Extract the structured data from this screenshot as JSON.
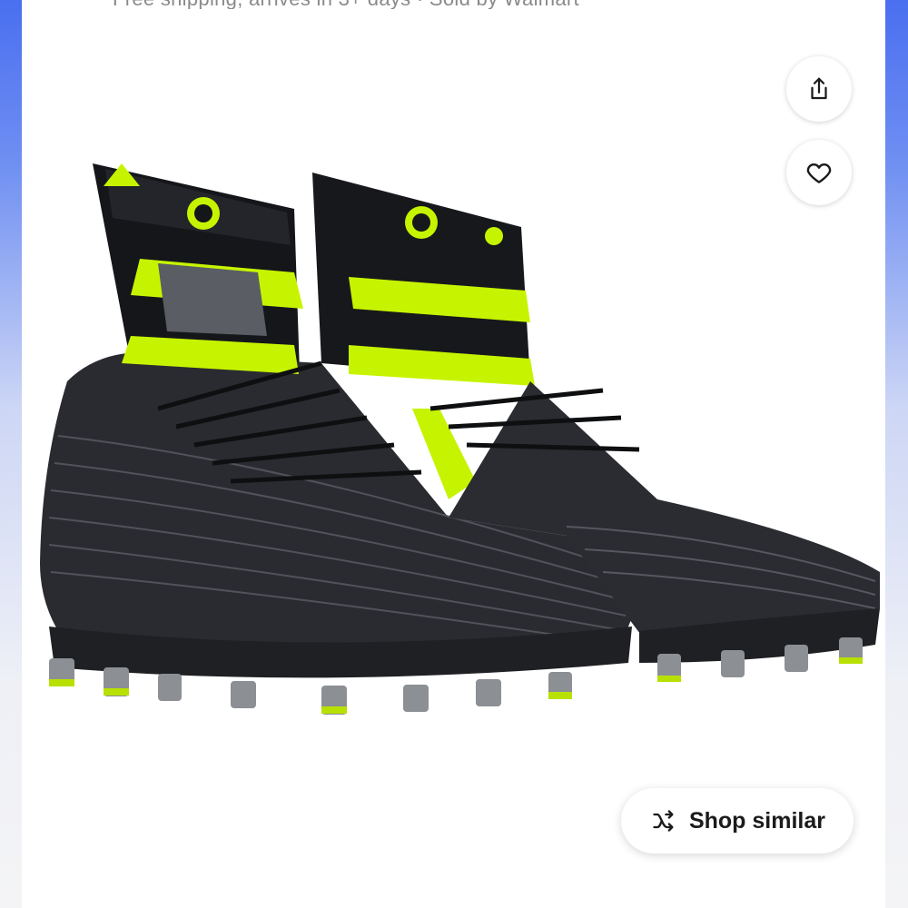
{
  "header": {
    "partial_text": "Free shipping, arrives in 3+ days · Sold by Walmart"
  },
  "actions": {
    "share_icon": "share-icon",
    "favorite_icon": "heart-icon"
  },
  "product": {
    "image_alt": "Black and neon yellow high-top football cleats"
  },
  "shop_similar": {
    "label": "Shop similar",
    "icon": "shuffle-icon"
  },
  "colors": {
    "accent_neon": "#c6f400",
    "shoe_black": "#1c1d1f"
  }
}
